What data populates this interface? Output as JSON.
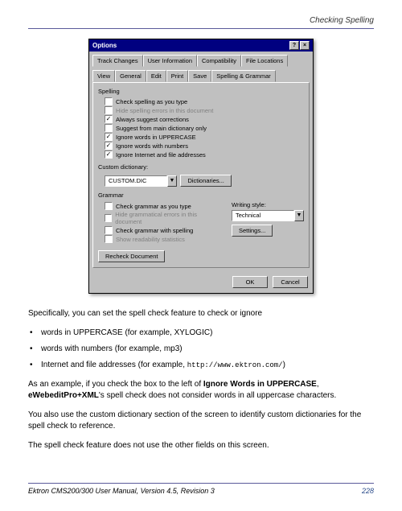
{
  "header": {
    "section": "Checking Spelling"
  },
  "dialog": {
    "title": "Options",
    "tabs_row1": [
      "Track Changes",
      "User Information",
      "Compatibility",
      "File Locations"
    ],
    "tabs_row2": [
      "View",
      "General",
      "Edit",
      "Print",
      "Save",
      "Spelling & Grammar"
    ],
    "spelling": {
      "label": "Spelling",
      "items": [
        {
          "label": "Check spelling as you type",
          "checked": false,
          "disabled": false
        },
        {
          "label": "Hide spelling errors in this document",
          "checked": false,
          "disabled": true
        },
        {
          "label": "Always suggest corrections",
          "checked": true,
          "disabled": false
        },
        {
          "label": "Suggest from main dictionary only",
          "checked": false,
          "disabled": false
        },
        {
          "label": "Ignore words in UPPERCASE",
          "checked": true,
          "disabled": false
        },
        {
          "label": "Ignore words with numbers",
          "checked": true,
          "disabled": false
        },
        {
          "label": "Ignore Internet and file addresses",
          "checked": true,
          "disabled": false
        }
      ]
    },
    "custom_dict": {
      "label": "Custom dictionary:",
      "value": "CUSTOM.DIC",
      "button": "Dictionaries..."
    },
    "grammar": {
      "label": "Grammar",
      "items": [
        {
          "label": "Check grammar as you type",
          "checked": false,
          "disabled": false
        },
        {
          "label": "Hide grammatical errors in this document",
          "checked": false,
          "disabled": true
        },
        {
          "label": "Check grammar with spelling",
          "checked": false,
          "disabled": false
        },
        {
          "label": "Show readability statistics",
          "checked": false,
          "disabled": true
        }
      ],
      "writing_style_label": "Writing style:",
      "writing_style_value": "Technical",
      "settings_button": "Settings..."
    },
    "recheck_button": "Recheck Document",
    "ok": "OK",
    "cancel": "Cancel"
  },
  "body": {
    "p1": "Specifically, you can set the spell check feature to check or ignore",
    "bullets": [
      "words in UPPERCASE (for example, XYLOGIC)",
      "words with numbers (for example, mp3)"
    ],
    "bullet3_a": "Internet and file addresses (for example, ",
    "bullet3_code": "http://www.ektron.com/",
    "bullet3_b": ")",
    "p2_a": "As an example, if you check the box to the left of ",
    "p2_b1": "Ignore Words in UPPERCASE",
    "p2_c": ", ",
    "p2_b2": "eWebeditPro+XML",
    "p2_d": "'s spell check does not consider words in all uppercase characters.",
    "p3": "You also use the custom dictionary section of the screen to identify custom dictionaries for the spell check to reference.",
    "p4": "The spell check feature does not use the other fields on this screen."
  },
  "footer": {
    "left": "Ektron CMS200/300 User Manual, Version 4.5, Revision 3",
    "right": "228"
  }
}
